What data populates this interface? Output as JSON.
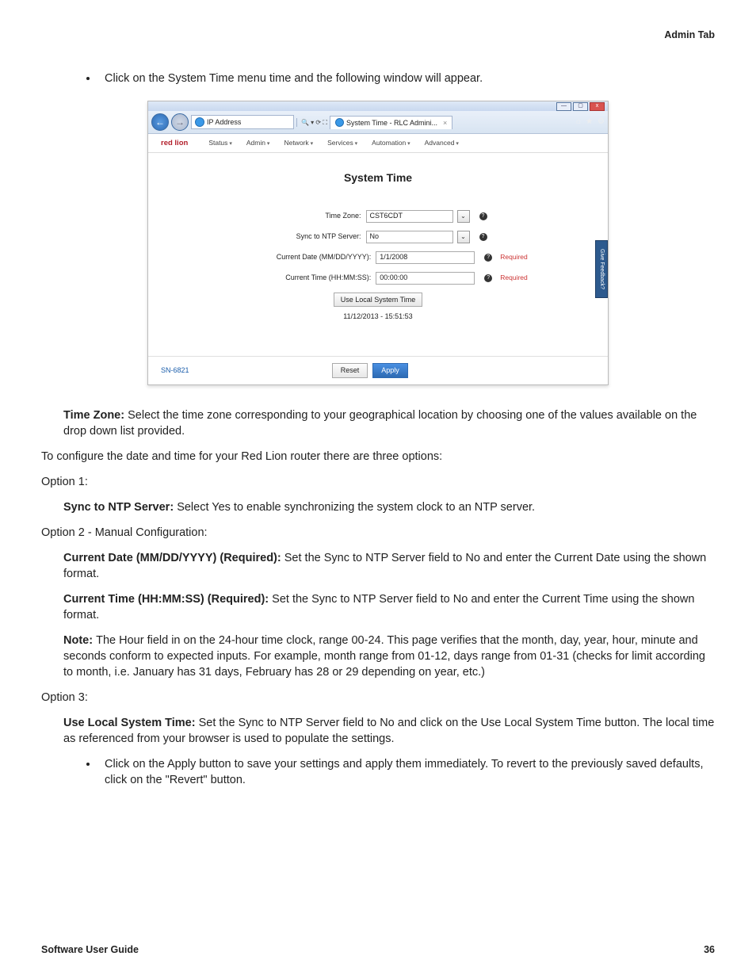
{
  "header": {
    "section": "Admin Tab"
  },
  "intro_bullet": "Click on the System Time menu time and the following window will appear.",
  "screenshot": {
    "window_btns": {
      "min": "—",
      "max": "▢",
      "close": "x"
    },
    "address_bar": {
      "text": "IP Address",
      "search_hint": "🔍 ▾  ⟳ ⛶"
    },
    "tab": {
      "title": "System Time - RLC Admini...",
      "close": "×"
    },
    "toolbar_icons": [
      "⌂",
      "★",
      "⚙"
    ],
    "brand": "red lion",
    "menu": [
      "Status",
      "Admin",
      "Network",
      "Services",
      "Automation",
      "Advanced"
    ],
    "page_title": "System Time",
    "fields": {
      "timezone": {
        "label": "Time Zone:",
        "value": "CST6CDT",
        "dropdown": "⌄"
      },
      "ntp": {
        "label": "Sync to NTP Server:",
        "value": "No",
        "dropdown": "⌄"
      },
      "date": {
        "label": "Current Date (MM/DD/YYYY):",
        "value": "1/1/2008",
        "required": "Required"
      },
      "time": {
        "label": "Current Time (HH:MM:SS):",
        "value": "00:00:00",
        "required": "Required"
      }
    },
    "local_btn": "Use Local System Time",
    "local_time": "11/12/2013 - 15:51:53",
    "sn": "SN-6821",
    "reset": "Reset",
    "apply": "Apply",
    "feedback": "Give Feedback?"
  },
  "paras": {
    "tz_label": "Time Zone: ",
    "tz_text": "Select the time zone corresponding to your geographical location by choosing one of the values available on the drop down list provided.",
    "cfg_intro": "To configure the date and time for your Red Lion router there are three options:",
    "opt1": "Option 1:",
    "ntp_label": "Sync to NTP Server: ",
    "ntp_text": "Select Yes to enable synchronizing the system clock to an NTP server.",
    "opt2": "Option 2 - Manual Configuration:",
    "date_label": "Current Date (MM/DD/YYYY) (Required): ",
    "date_text": "Set the Sync to NTP Server field to No and enter the Current Date using the shown format.",
    "time_label": "Current Time (HH:MM:SS) (Required): ",
    "time_text": "Set the Sync to NTP Server field to No and enter the Current Time using the shown format.",
    "note_label": "Note: ",
    "note_text": "The Hour field in on the 24-hour time clock, range 00-24. This page verifies that the month, day, year, hour, minute and seconds conform to expected inputs. For example, month range from 01-12, days range from 01-31 (checks for limit according to month, i.e. January has 31 days, February has 28 or 29 depending on year, etc.)",
    "opt3": "Option 3:",
    "local_label": "Use Local System Time: ",
    "local_text": "Set the Sync to NTP Server field to No and click on the Use Local System Time button. The local time as referenced from your browser is used to populate the settings.",
    "apply_bullet": "Click on the Apply button to save your settings and apply them immediately. To revert to the previously saved defaults, click on the \"Revert\" button."
  },
  "footer": {
    "left": "Software User Guide",
    "right": "36"
  }
}
